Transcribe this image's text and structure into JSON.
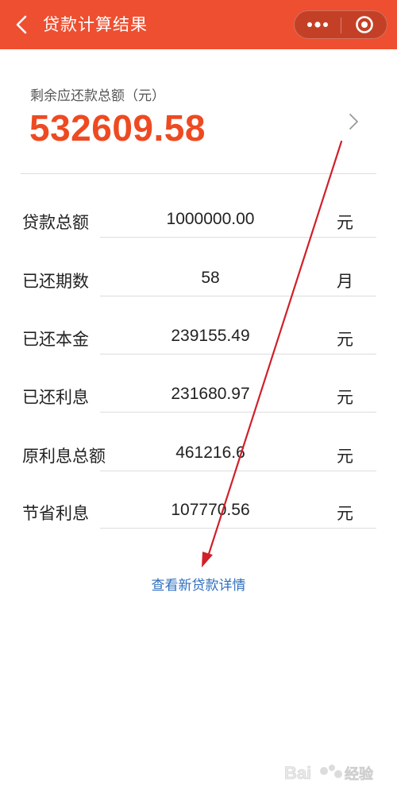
{
  "header": {
    "title": "贷款计算结果",
    "bg_color": "#ee4f30"
  },
  "summary": {
    "label": "剩余应还款总额（元）",
    "amount": "532609.58",
    "amount_color": "#ee4a22"
  },
  "rows": [
    {
      "label": "贷款总额",
      "value": "1000000.00",
      "unit": "元"
    },
    {
      "label": "已还期数",
      "value": "58",
      "unit": "月"
    },
    {
      "label": "已还本金",
      "value": "239155.49",
      "unit": "元"
    },
    {
      "label": "已还利息",
      "value": "231680.97",
      "unit": "元"
    },
    {
      "label": "原利息总额",
      "value": "461216.6",
      "unit": "元"
    },
    {
      "label": "节省利息",
      "value": "107770.56",
      "unit": "元"
    }
  ],
  "detail_link": "查看新贷款详情",
  "link_color": "#2f6fbf",
  "annotation_color": "#d0202a",
  "icons": {
    "back": "chevron-left-icon",
    "more": "more-dots-icon",
    "close": "target-circle-icon",
    "summary_arrow": "chevron-right-icon"
  },
  "watermark": "Baidu经验"
}
